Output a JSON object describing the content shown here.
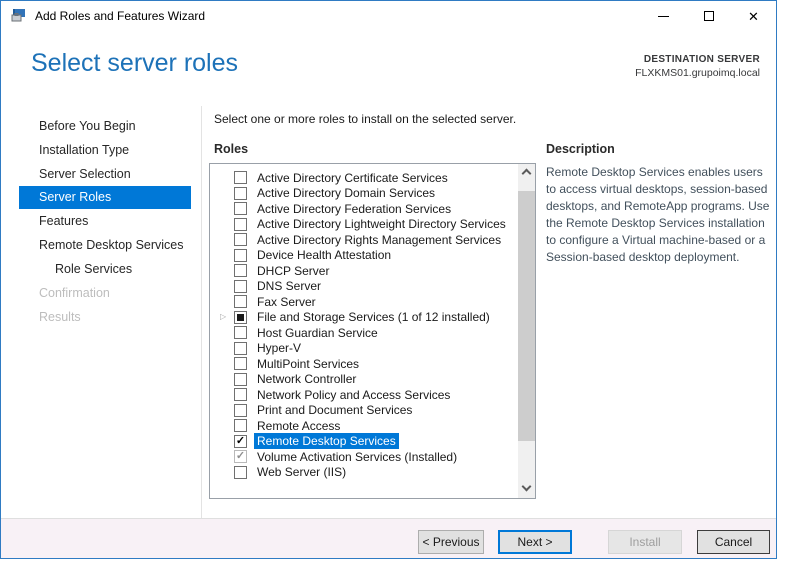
{
  "window": {
    "title": "Add Roles and Features Wizard"
  },
  "header": {
    "title": "Select server roles",
    "destination_label": "DESTINATION SERVER",
    "destination_server": "FLXKMS01.grupoimq.local"
  },
  "sidebar": {
    "items": [
      {
        "label": "Before You Begin",
        "state": "normal",
        "indent": false
      },
      {
        "label": "Installation Type",
        "state": "normal",
        "indent": false
      },
      {
        "label": "Server Selection",
        "state": "normal",
        "indent": false
      },
      {
        "label": "Server Roles",
        "state": "selected",
        "indent": false
      },
      {
        "label": "Features",
        "state": "normal",
        "indent": false
      },
      {
        "label": "Remote Desktop Services",
        "state": "normal",
        "indent": false
      },
      {
        "label": "Role Services",
        "state": "normal",
        "indent": true
      },
      {
        "label": "Confirmation",
        "state": "disabled",
        "indent": false
      },
      {
        "label": "Results",
        "state": "disabled",
        "indent": false
      }
    ]
  },
  "main": {
    "instruction": "Select one or more roles to install on the selected server.",
    "roles_label": "Roles",
    "roles": [
      {
        "label": "Active Directory Certificate Services",
        "checkbox": "unchecked",
        "expandable": false,
        "selected": false
      },
      {
        "label": "Active Directory Domain Services",
        "checkbox": "unchecked",
        "expandable": false,
        "selected": false
      },
      {
        "label": "Active Directory Federation Services",
        "checkbox": "unchecked",
        "expandable": false,
        "selected": false
      },
      {
        "label": "Active Directory Lightweight Directory Services",
        "checkbox": "unchecked",
        "expandable": false,
        "selected": false
      },
      {
        "label": "Active Directory Rights Management Services",
        "checkbox": "unchecked",
        "expandable": false,
        "selected": false
      },
      {
        "label": "Device Health Attestation",
        "checkbox": "unchecked",
        "expandable": false,
        "selected": false
      },
      {
        "label": "DHCP Server",
        "checkbox": "unchecked",
        "expandable": false,
        "selected": false
      },
      {
        "label": "DNS Server",
        "checkbox": "unchecked",
        "expandable": false,
        "selected": false
      },
      {
        "label": "Fax Server",
        "checkbox": "unchecked",
        "expandable": false,
        "selected": false
      },
      {
        "label": "File and Storage Services (1 of 12 installed)",
        "checkbox": "indeterminate",
        "expandable": true,
        "selected": false
      },
      {
        "label": "Host Guardian Service",
        "checkbox": "unchecked",
        "expandable": false,
        "selected": false
      },
      {
        "label": "Hyper-V",
        "checkbox": "unchecked",
        "expandable": false,
        "selected": false
      },
      {
        "label": "MultiPoint Services",
        "checkbox": "unchecked",
        "expandable": false,
        "selected": false
      },
      {
        "label": "Network Controller",
        "checkbox": "unchecked",
        "expandable": false,
        "selected": false
      },
      {
        "label": "Network Policy and Access Services",
        "checkbox": "unchecked",
        "expandable": false,
        "selected": false
      },
      {
        "label": "Print and Document Services",
        "checkbox": "unchecked",
        "expandable": false,
        "selected": false
      },
      {
        "label": "Remote Access",
        "checkbox": "unchecked",
        "expandable": false,
        "selected": false
      },
      {
        "label": "Remote Desktop Services",
        "checkbox": "checked",
        "expandable": false,
        "selected": true
      },
      {
        "label": "Volume Activation Services (Installed)",
        "checkbox": "checked-disabled",
        "expandable": false,
        "selected": false
      },
      {
        "label": "Web Server (IIS)",
        "checkbox": "unchecked",
        "expandable": false,
        "selected": false
      }
    ]
  },
  "description": {
    "label": "Description",
    "text": "Remote Desktop Services enables users to access virtual desktops, session-based desktops, and RemoteApp programs. Use the Remote Desktop Services installation to configure a Virtual machine-based or a Session-based desktop deployment."
  },
  "footer": {
    "previous_label": "< Previous",
    "next_label": "Next >",
    "install_label": "Install",
    "cancel_label": "Cancel"
  },
  "icons": {
    "close": "✕",
    "checkmark": "✓",
    "expander": "▷"
  },
  "colors": {
    "accent_blue": "#0078d7",
    "title_blue": "#1d72b8",
    "window_border": "#2f7bc3",
    "footer_background": "#f8f1f6",
    "disabled_text": "#bdbdbd"
  }
}
